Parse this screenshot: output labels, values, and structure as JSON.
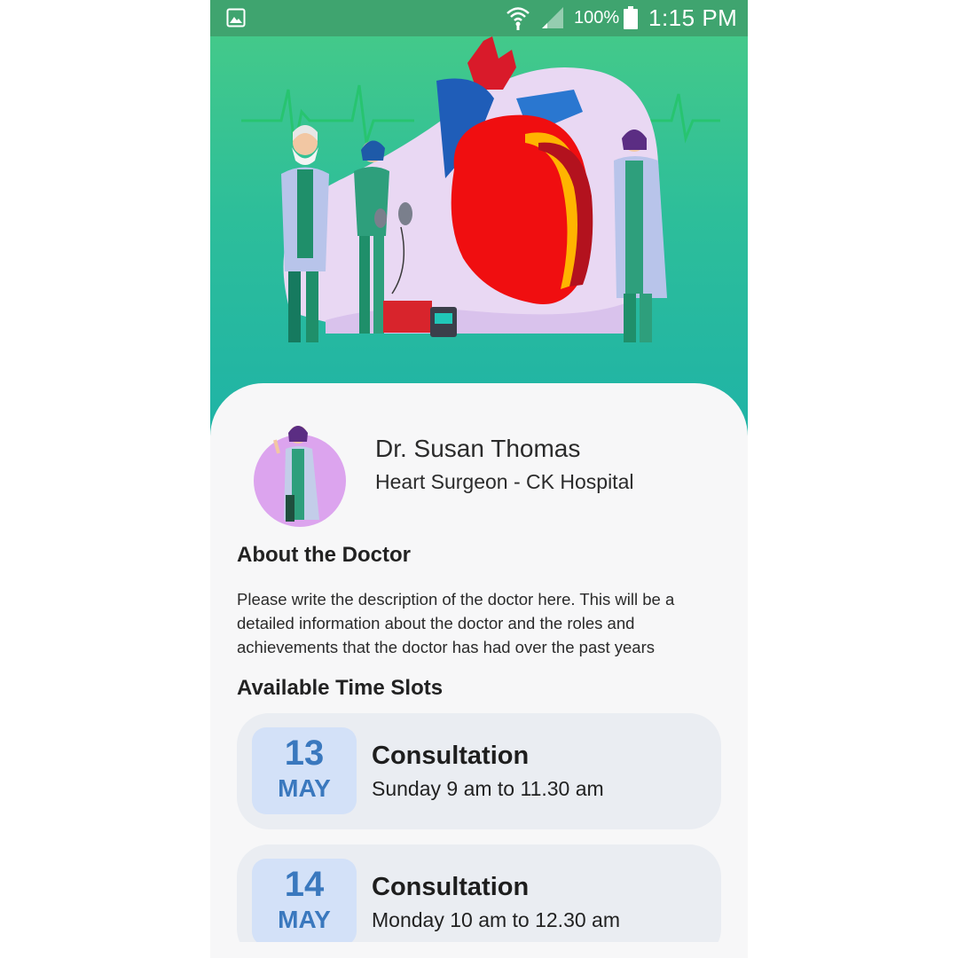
{
  "status_bar": {
    "battery": "100%",
    "time": "1:15 PM",
    "icons": [
      "gallery-icon",
      "wifi-icon",
      "signal-icon",
      "battery-icon"
    ]
  },
  "doctor": {
    "name": "Dr. Susan Thomas",
    "role": "Heart Surgeon - CK Hospital"
  },
  "about": {
    "title": "About the Doctor",
    "text": "Please write the description of the doctor here. This will be a detailed information about the doctor and the roles and achievements that the doctor has had over the past years"
  },
  "slots": {
    "title": "Available Time Slots",
    "items": [
      {
        "day": "13",
        "month": "MAY",
        "title": "Consultation",
        "time": "Sunday 9 am to 11.30 am"
      },
      {
        "day": "14",
        "month": "MAY",
        "title": "Consultation",
        "time": "Monday 10 am to 12.30 am"
      }
    ]
  },
  "colors": {
    "status_bar": "#3fa46f",
    "hero_top": "#43c98a",
    "hero_bottom": "#1fb3a6",
    "slot_bg": "#eaedf2",
    "date_bg": "#d3e1f8",
    "date_text": "#3a78be"
  }
}
